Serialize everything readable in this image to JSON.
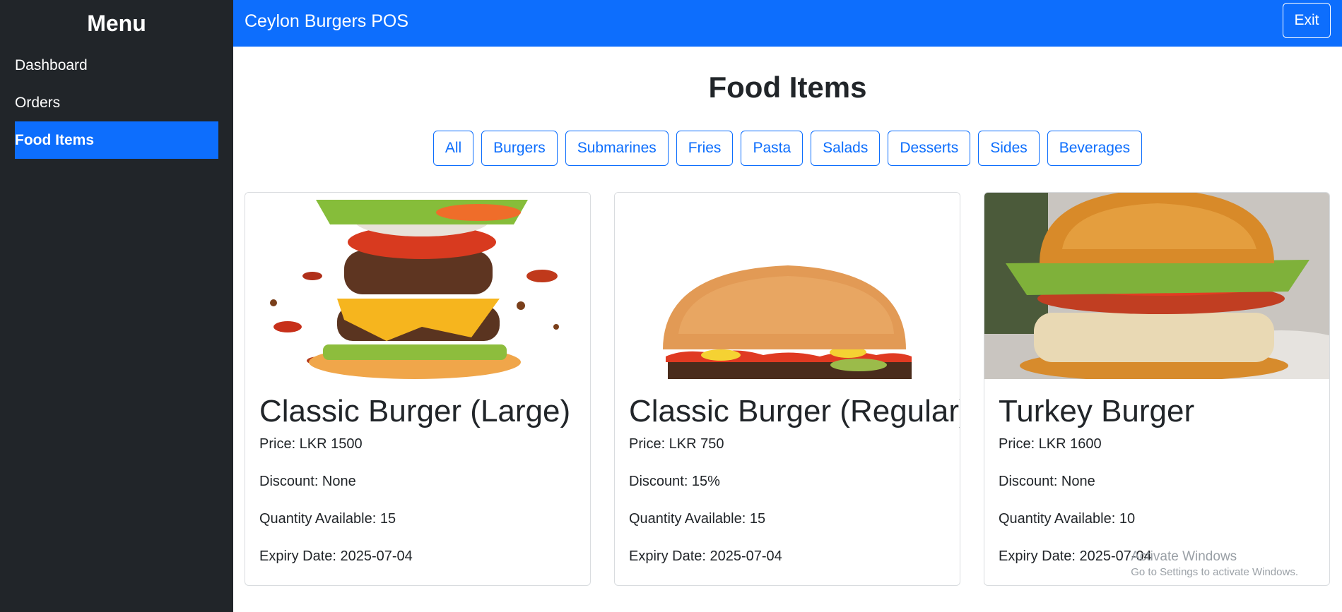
{
  "sidebar": {
    "title": "Menu",
    "items": [
      {
        "label": "Dashboard",
        "active": false
      },
      {
        "label": "Orders",
        "active": false
      },
      {
        "label": "Food Items",
        "active": true
      }
    ]
  },
  "topbar": {
    "brand": "Ceylon Burgers POS",
    "exit_label": "Exit"
  },
  "main": {
    "title": "Food Items",
    "filters": [
      "All",
      "Burgers",
      "Submarines",
      "Fries",
      "Pasta",
      "Salads",
      "Desserts",
      "Sides",
      "Beverages"
    ],
    "items": [
      {
        "name": "Classic Burger (Large)",
        "price": "Price: LKR 1500",
        "discount": "Discount: None",
        "quantity": "Quantity Available: 15",
        "expiry": "Expiry Date: 2025-07-04"
      },
      {
        "name": "Classic Burger (Regular)",
        "price": "Price: LKR 750",
        "discount": "Discount: 15%",
        "quantity": "Quantity Available: 15",
        "expiry": "Expiry Date: 2025-07-04"
      },
      {
        "name": "Turkey Burger",
        "price": "Price: LKR 1600",
        "discount": "Discount: None",
        "quantity": "Quantity Available: 10",
        "expiry": "Expiry Date: 2025-07-04"
      }
    ]
  },
  "watermark": {
    "line1": "Activate Windows",
    "line2": "Go to Settings to activate Windows."
  },
  "colors": {
    "primary": "#0d6efd",
    "sidebar_bg": "#212529"
  }
}
